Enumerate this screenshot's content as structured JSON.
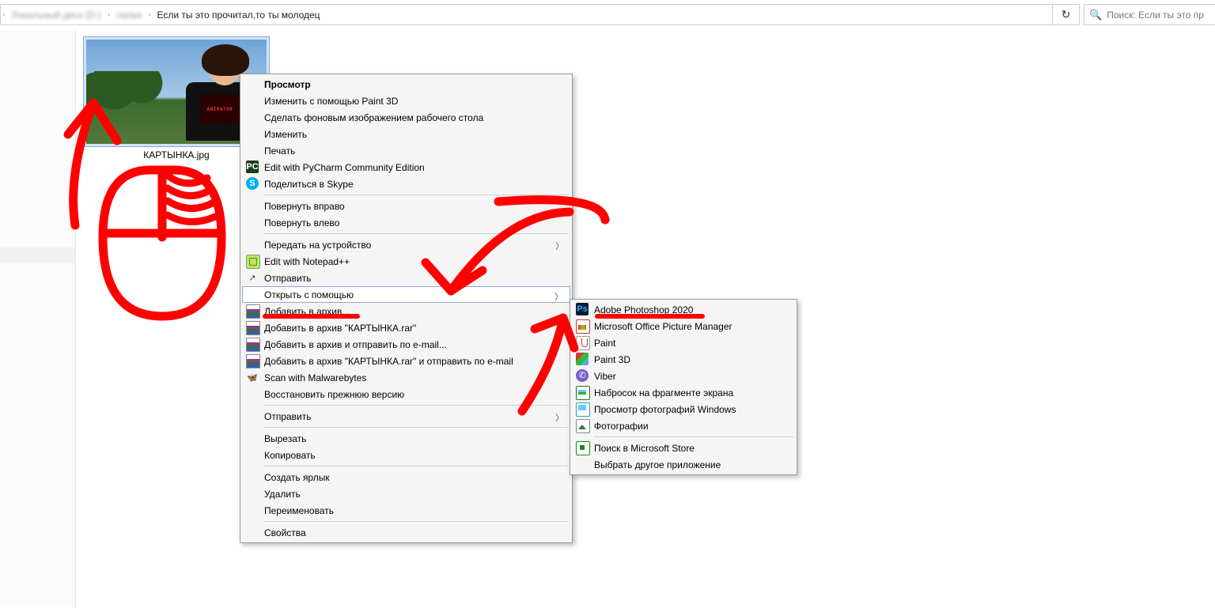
{
  "breadcrumb": {
    "seg1_blur": "Локальный диск (D:)",
    "seg2_blur": "папка",
    "seg3": "Если ты это прочитал,то ты молодец"
  },
  "toolbar": {
    "refresh_symbol": "↻",
    "search_placeholder": "Поиск: Если ты это пр"
  },
  "file": {
    "name": "КАРТЫНКА.jpg",
    "shirt_text": "ANIMATOR"
  },
  "menu1": {
    "view": "Просмотр",
    "paint3d": "Изменить с помощью Paint 3D",
    "wallpaper": "Сделать фоновым изображением рабочего стола",
    "edit": "Изменить",
    "print": "Печать",
    "pycharm": "Edit with PyCharm Community Edition",
    "skype": "Поделиться в Skype",
    "rot_r": "Повернуть вправо",
    "rot_l": "Повернуть влево",
    "cast": "Передать на устройство",
    "npp": "Edit with Notepad++",
    "share": "Отправить",
    "openwith": "Открыть с помощью",
    "arch1": "Добавить в архив...",
    "arch2": "Добавить в архив \"КАРТЫНКА.rar\"",
    "arch3": "Добавить в архив и отправить по e-mail...",
    "arch4": "Добавить в архив \"КАРТЫНКА.rar\" и отправить по e-mail",
    "malware": "Scan with Malwarebytes",
    "restore": "Восстановить прежнюю версию",
    "sendto": "Отправить",
    "cut": "Вырезать",
    "copy": "Копировать",
    "shortcut": "Создать ярлык",
    "delete": "Удалить",
    "rename": "Переименовать",
    "props": "Свойства"
  },
  "menu2": {
    "ps": "Adobe Photoshop 2020",
    "mopm": "Microsoft Office Picture Manager",
    "paint": "Paint",
    "paint3d": "Paint 3D",
    "viber": "Viber",
    "snip": "Набросок на фрагменте экрана",
    "winphoto": "Просмотр фотографий Windows",
    "photos": "Фотографии",
    "store": "Поиск в Microsoft Store",
    "other": "Выбрать другое приложение"
  }
}
